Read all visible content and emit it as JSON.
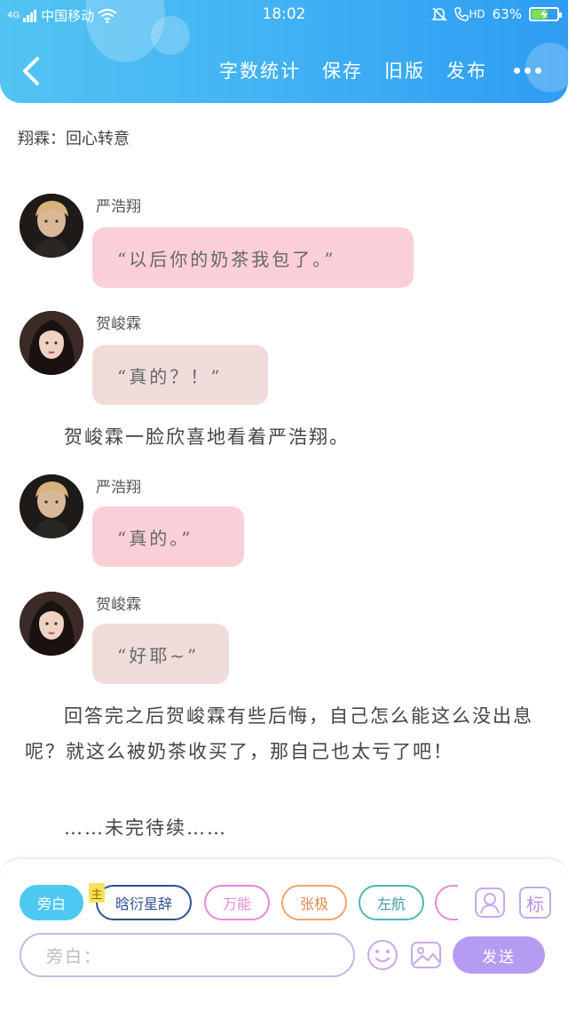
{
  "status_bar": {
    "network": "4G",
    "carrier": "中国移动",
    "time": "18:02",
    "volte": "HD",
    "battery_percent": "63%",
    "battery_level": 0.63
  },
  "nav": {
    "back_icon": "chevron-left-icon",
    "word_count": "字数统计",
    "save": "保存",
    "old_version": "旧版",
    "publish": "发布",
    "more_icon": "ellipsis-icon"
  },
  "cp_line": "翔霖：回心转意",
  "messages": [
    {
      "sender": "严浩翔",
      "text": "“以后你的奶茶我包了。”",
      "style": "pink"
    },
    {
      "sender": "贺峻霖",
      "text": "“真的？！”",
      "style": "beige"
    },
    {
      "sender": "严浩翔",
      "text": "“真的。”",
      "style": "pink"
    },
    {
      "sender": "贺峻霖",
      "text": "“好耶~”",
      "style": "beige"
    }
  ],
  "narrations": [
    "贺峻霖一脸欣喜地看着严浩翔。",
    "回答完之后贺峻霖有些后悔，自己怎么能这么没出息呢？就这么被奶茶收买了，那自己也太亏了吧！",
    "……未完待续……"
  ],
  "bottom": {
    "chips": [
      {
        "label": "旁白",
        "color": "#4ec8f2"
      },
      {
        "label": "晗衍星辞",
        "color": "#2f4f8f"
      },
      {
        "label": "万能",
        "color": "#e58ad8"
      },
      {
        "label": "张极",
        "color": "#f0a46a"
      },
      {
        "label": "左航",
        "color": "#4db8b0"
      },
      {
        "label": "",
        "color": "#e58ad8"
      }
    ],
    "main_tag": "主",
    "role_icon": "person-icon",
    "label_icon": "标",
    "input_placeholder": "旁白：",
    "emoji_icon": "smiley-icon",
    "image_icon": "image-icon",
    "send_label": "发送"
  },
  "colors": {
    "header_start": "#52c4f2",
    "header_end": "#2e9cf3",
    "bubble_pink": "#fbcfd8",
    "bubble_beige": "#f1dcdc",
    "send_button": "#b59cf2"
  }
}
